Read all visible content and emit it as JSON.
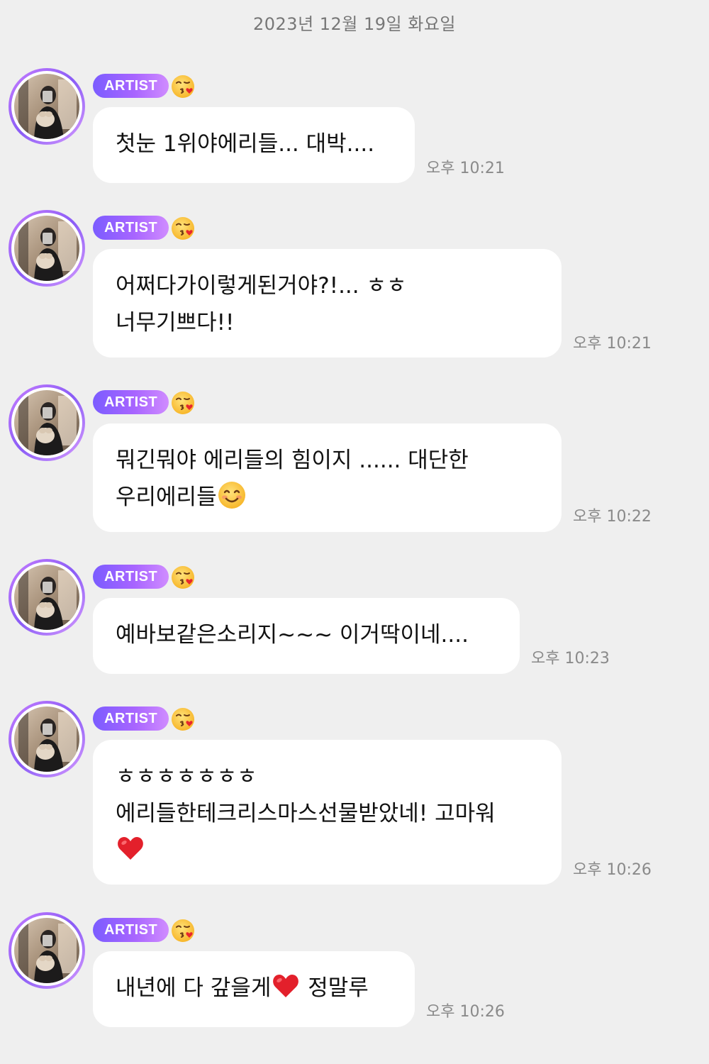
{
  "date_header": "2023년 12월 19일 화요일",
  "colors": {
    "background": "#efefef",
    "bubble": "#ffffff",
    "badge_gradient_start": "#7b5cff",
    "badge_gradient_end": "#d08cff",
    "timestamp": "#8a8a8a"
  },
  "messages": [
    {
      "badge": "ARTIST",
      "badge_emoji": "face-blowing-kiss-icon",
      "lines": [
        "첫눈 1위야에리들... 대박...."
      ],
      "time": "오후 10:21"
    },
    {
      "badge": "ARTIST",
      "badge_emoji": "face-blowing-kiss-icon",
      "lines": [
        "어쩌다가이렇게된거야?!... ㅎㅎ",
        "너무기쁘다!!"
      ],
      "time": "오후 10:21"
    },
    {
      "badge": "ARTIST",
      "badge_emoji": "face-blowing-kiss-icon",
      "lines": [
        "뭐긴뭐야 에리들의 힘이지 ...... 대단한",
        "우리에리들"
      ],
      "trailing_emoji": "smiling-face-icon",
      "time": "오후 10:22"
    },
    {
      "badge": "ARTIST",
      "badge_emoji": "face-blowing-kiss-icon",
      "lines": [
        "예바보같은소리지~~~ 이거딱이네...."
      ],
      "time": "오후 10:23"
    },
    {
      "badge": "ARTIST",
      "badge_emoji": "face-blowing-kiss-icon",
      "lines": [
        "ㅎㅎㅎㅎㅎㅎㅎ",
        "에리들한테크리스마스선물받았네! 고마워"
      ],
      "trailing_emoji": "red-heart-icon",
      "time": "오후 10:26"
    },
    {
      "badge": "ARTIST",
      "badge_emoji": "face-blowing-kiss-icon",
      "lines_parts": [
        "내년에 다 갚을게",
        "정말루"
      ],
      "inline_emoji": "red-heart-icon",
      "time": "오후 10:26"
    }
  ]
}
